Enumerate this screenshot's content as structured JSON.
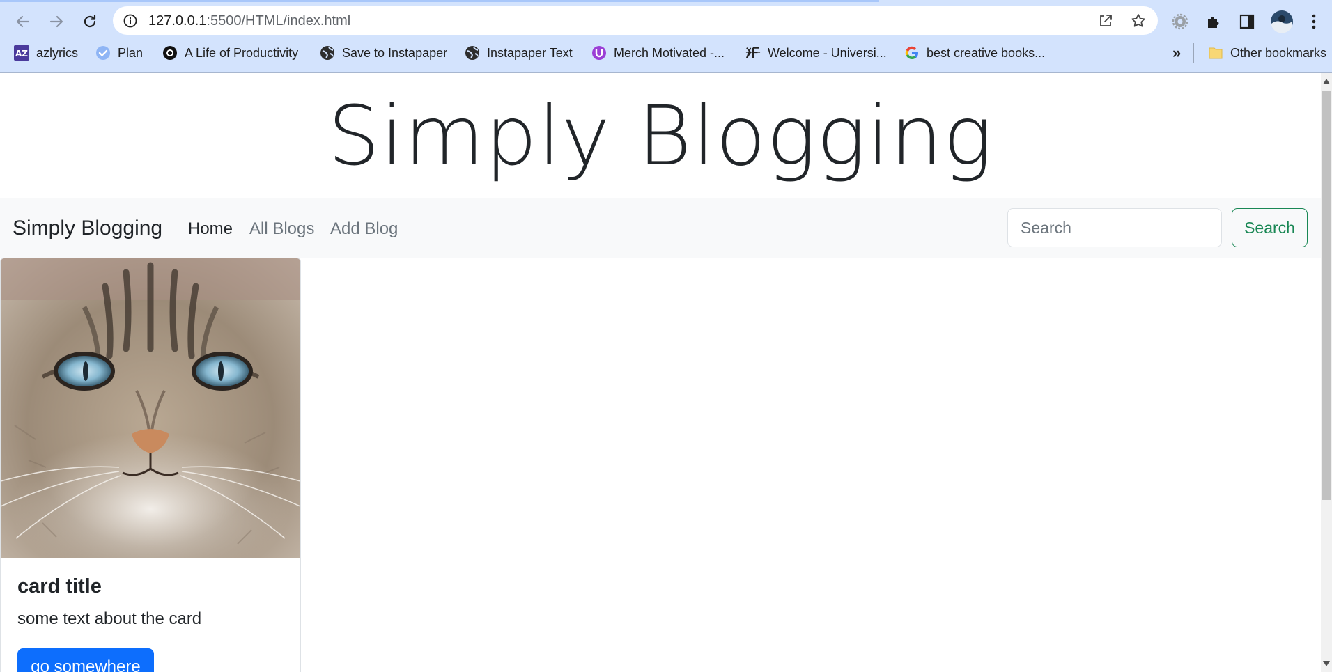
{
  "browser": {
    "url_host": "127.0.0.1",
    "url_path": ":5500/HTML/index.html",
    "load_progress": 0.66,
    "bookmarks": [
      {
        "label": "azlyrics",
        "icon": "azlyrics-icon"
      },
      {
        "label": "Plan",
        "icon": "checkmark-icon"
      },
      {
        "label": "A Life of Productivity",
        "icon": "productivity-icon"
      },
      {
        "label": "Save to Instapaper",
        "icon": "globe-icon"
      },
      {
        "label": "Instapaper Text",
        "icon": "globe-icon"
      },
      {
        "label": "Merch Motivated -...",
        "icon": "merch-icon"
      },
      {
        "label": "Welcome - Universi...",
        "icon": "university-icon"
      },
      {
        "label": "best creative books...",
        "icon": "google-icon"
      }
    ],
    "overflow": "»",
    "other_bookmarks": "Other bookmarks",
    "colors": {
      "chrome": "#d3e3fd"
    }
  },
  "page": {
    "hero_title": "Simply Blogging",
    "navbar": {
      "brand": "Simply Blogging",
      "links": [
        {
          "label": "Home",
          "active": true
        },
        {
          "label": "All Blogs",
          "active": false
        },
        {
          "label": "Add Blog",
          "active": false
        }
      ],
      "search_placeholder": "Search",
      "search_button": "Search"
    },
    "card": {
      "image": "cat-photo",
      "title": "card title",
      "text": "some text about the card",
      "button": "go somewhere"
    },
    "colors": {
      "primary": "#0d6efd",
      "success": "#198754",
      "navbar_bg": "#f8f9fa"
    }
  }
}
